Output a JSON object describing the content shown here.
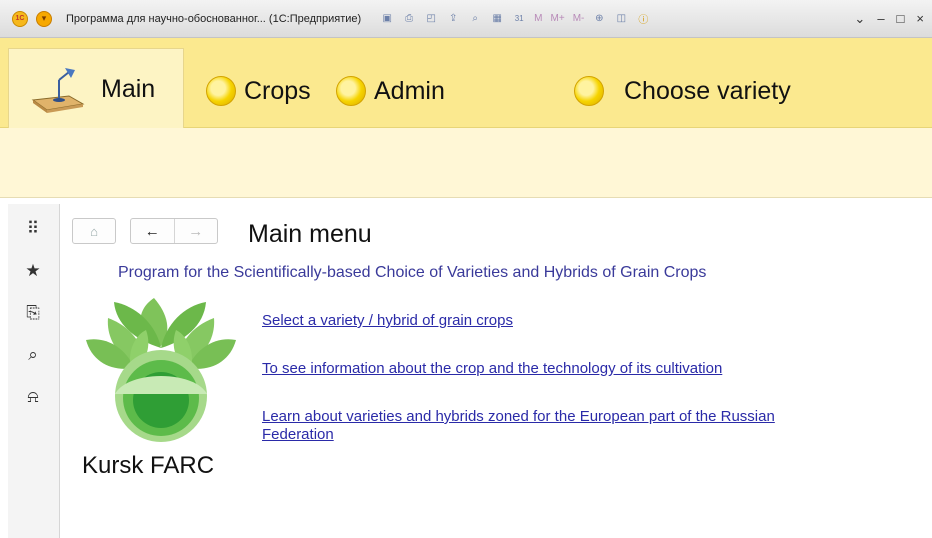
{
  "window": {
    "logo": "1C",
    "title": "Программа для научно-обоснованног... (1С:Предприятие)",
    "toolbar": [
      {
        "icon": "save-icon",
        "glyph": "▣"
      },
      {
        "icon": "print-icon",
        "glyph": "⎙"
      },
      {
        "icon": "preview-icon",
        "glyph": "◰"
      },
      {
        "icon": "upload-icon",
        "glyph": "⇪"
      },
      {
        "icon": "find-icon",
        "glyph": "⌕"
      },
      {
        "icon": "calculator-icon",
        "glyph": "▦"
      },
      {
        "icon": "calendar-icon",
        "glyph": "31"
      },
      {
        "icon": "memory-icon",
        "glyph": "M"
      },
      {
        "icon": "memory-plus-icon",
        "glyph": "M+"
      },
      {
        "icon": "memory-minus-icon",
        "glyph": "M-"
      },
      {
        "icon": "zoom-icon",
        "glyph": "⊕"
      },
      {
        "icon": "panel-icon",
        "glyph": "◫"
      },
      {
        "icon": "info-icon",
        "glyph": "ⓘ"
      }
    ],
    "controls": {
      "dropdown": "⌄",
      "minimize": "–",
      "maximize": "□",
      "close": "×"
    }
  },
  "sections": {
    "main": "Main",
    "crops": "Crops",
    "admin": "Admin",
    "choose": "Choose variety"
  },
  "left_panel": [
    {
      "icon": "apps-grid-icon",
      "glyph": "⠿"
    },
    {
      "icon": "favorites-star-icon",
      "glyph": "★"
    },
    {
      "icon": "history-icon",
      "glyph": "⎘"
    },
    {
      "icon": "search-icon",
      "glyph": "⌕"
    },
    {
      "icon": "notifications-bell-icon",
      "glyph": "⍾"
    }
  ],
  "content": {
    "nav": {
      "home": "⌂",
      "back": "←",
      "forward": "→"
    },
    "title": "Main menu",
    "program": "Program for the Scientifically-based Choice of Varieties and Hybrids of Grain Crops",
    "links": [
      "Select a variety / hybrid of grain crops",
      "To see information about the crop and the technology of its cultivation",
      "Learn about varieties and hybrids zoned for the European part of the Russian Federation"
    ],
    "org": "Kursk FARC"
  },
  "colors": {
    "section_bar": "#fbe98f",
    "strip": "#fff7d6",
    "link": "#2a2aa8",
    "logo_green": "#3faa3a"
  }
}
